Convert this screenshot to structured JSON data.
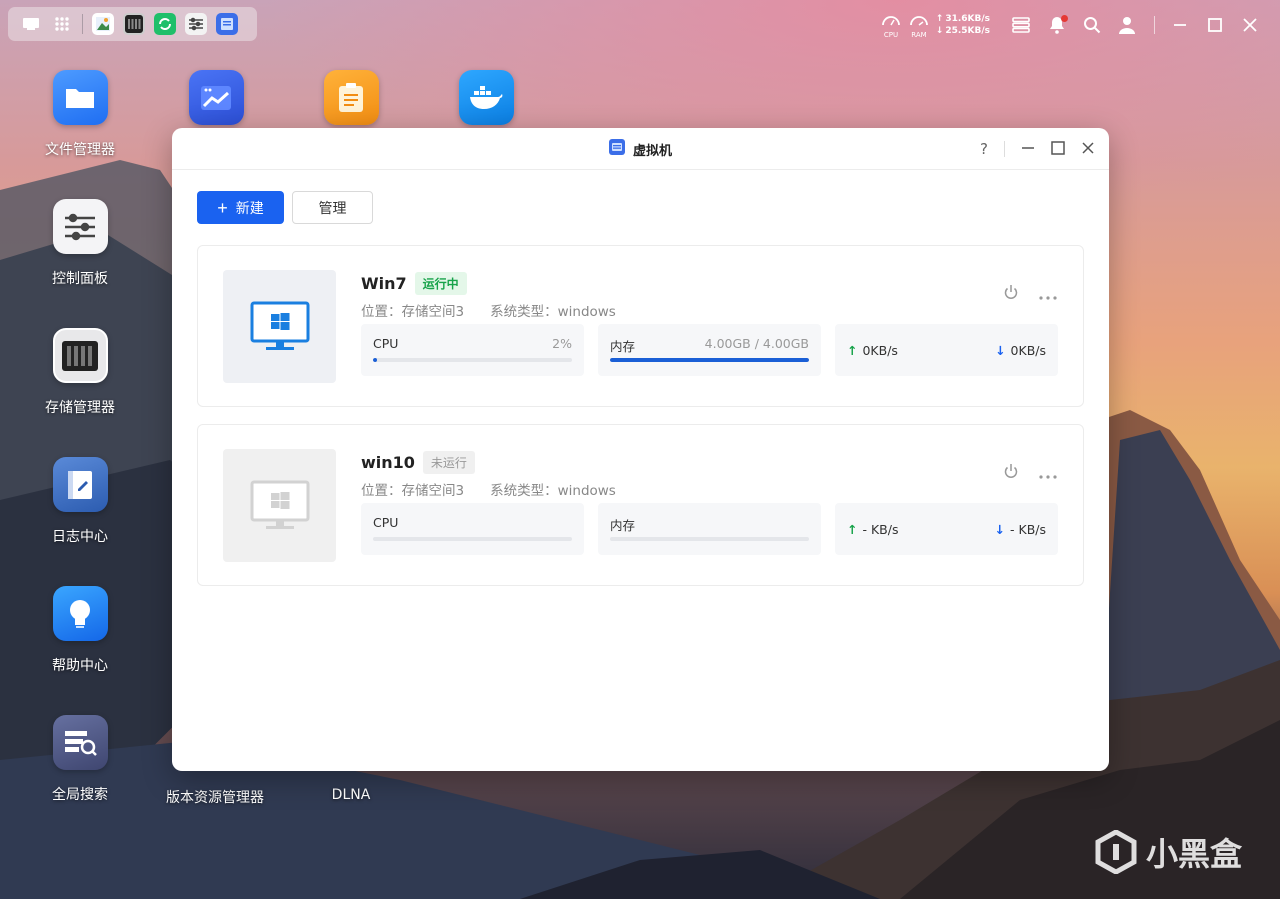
{
  "topbar": {
    "cpu_label": "CPU",
    "ram_label": "RAM",
    "net_up": "31.6KB/s",
    "net_down": "25.5KB/s"
  },
  "desktop": {
    "icons": [
      {
        "label": "文件管理器"
      },
      {
        "label": "控制面板"
      },
      {
        "label": "存储管理器"
      },
      {
        "label": "日志中心"
      },
      {
        "label": "帮助中心"
      },
      {
        "label": "全局搜索"
      }
    ],
    "bottom_labels": [
      "版本资源管理器",
      "DLNA"
    ]
  },
  "window": {
    "title": "虚拟机",
    "help": "?",
    "new_button": "新建",
    "manage_button": "管理"
  },
  "vms": [
    {
      "name": "Win7",
      "status": "运行中",
      "location": "位置：存储空间3",
      "os_type": "系统类型：windows",
      "cpu_label": "CPU",
      "cpu_value": "2%",
      "cpu_fraction": 0.02,
      "mem_label": "内存",
      "mem_value": "4.00GB / 4.00GB",
      "mem_fraction": 1.0,
      "up": "0KB/s",
      "down": "0KB/s"
    },
    {
      "name": "win10",
      "status": "未运行",
      "location": "位置：存储空间3",
      "os_type": "系统类型：windows",
      "cpu_label": "CPU",
      "cpu_value": "",
      "cpu_fraction": 0,
      "mem_label": "内存",
      "mem_value": "",
      "mem_fraction": 0,
      "up": "- KB/s",
      "down": "- KB/s"
    }
  ],
  "watermark": "小黑盒",
  "colors": {
    "accent": "#1a62f0",
    "running": "#17a34a",
    "up_arrow": "#17a34a",
    "down_arrow": "#1a62f0"
  }
}
